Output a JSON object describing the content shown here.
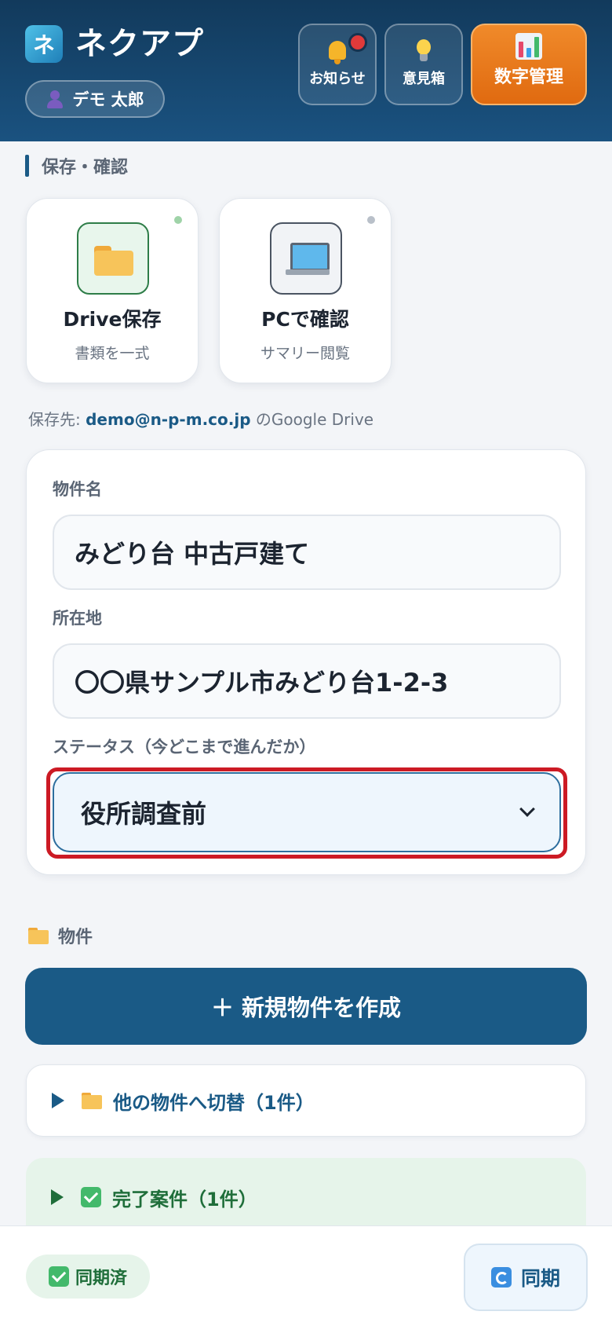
{
  "header": {
    "logo_glyph": "ネ",
    "app_title": "ネクアプ",
    "user_name": "デモ 太郎",
    "buttons": {
      "notifications": "お知らせ",
      "ideas": "意見箱",
      "numbers": "数字管理"
    }
  },
  "storage": {
    "section_title": "保存・確認",
    "cards": [
      {
        "title": "Drive保存",
        "subtitle": "書類を一式",
        "icon": "folder-icon"
      },
      {
        "title": "PCで確認",
        "subtitle": "サマリー閲覧",
        "icon": "laptop-icon"
      }
    ],
    "save_destination": {
      "prefix": "保存先: ",
      "email": "demo@n-p-m.co.jp",
      "suffix": " のGoogle Drive"
    }
  },
  "form": {
    "property_name_label": "物件名",
    "property_name_value": "みどり台 中古戸建て",
    "location_label": "所在地",
    "location_value": "〇〇県サンプル市みどり台1-2-3",
    "status_label": "ステータス（今どこまで進んだか）",
    "status_value": "役所調査前"
  },
  "properties": {
    "section_title": "物件",
    "new_button": "＋ 新規物件を作成",
    "switch_label": "他の物件へ切替（1件）",
    "completed_label": "完了案件（1件）"
  },
  "footer": {
    "sync_status": "同期済",
    "sync_button": "同期"
  },
  "colors": {
    "header_bg": "#123a5c",
    "primary": "#1a5a86",
    "accent_orange": "#e06a10",
    "success": "#1f6e3a",
    "focus_ring": "#cc1a24"
  }
}
